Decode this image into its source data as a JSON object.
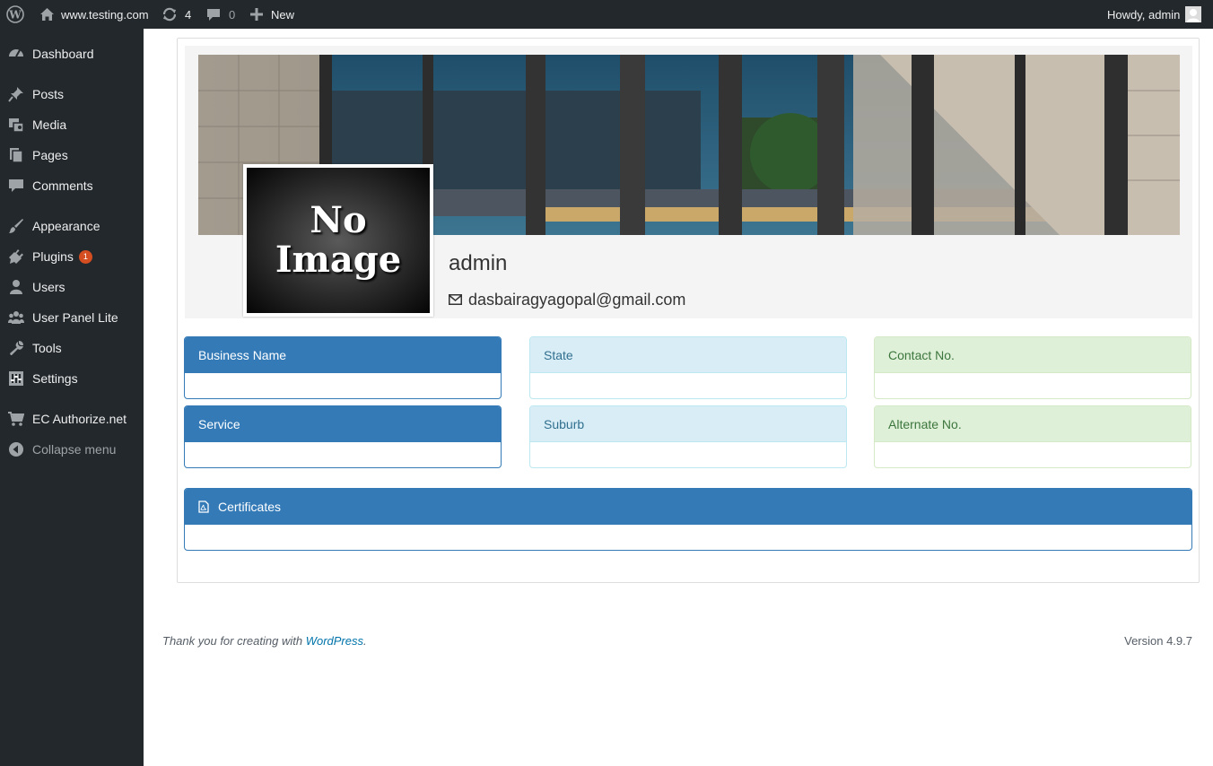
{
  "admin_bar": {
    "site_name": "www.testing.com",
    "updates_count": "4",
    "comments_count": "0",
    "new_label": "New",
    "howdy": "Howdy, admin"
  },
  "sidebar": {
    "items": [
      {
        "label": "Dashboard",
        "icon": "dashboard-icon"
      },
      {
        "label": "Posts",
        "icon": "pin-icon"
      },
      {
        "label": "Media",
        "icon": "media-icon"
      },
      {
        "label": "Pages",
        "icon": "pages-icon"
      },
      {
        "label": "Comments",
        "icon": "comment-icon"
      },
      {
        "label": "Appearance",
        "icon": "brush-icon"
      },
      {
        "label": "Plugins",
        "icon": "plug-icon",
        "badge": "1"
      },
      {
        "label": "Users",
        "icon": "user-icon"
      },
      {
        "label": "User Panel Lite",
        "icon": "group-icon"
      },
      {
        "label": "Tools",
        "icon": "wrench-icon"
      },
      {
        "label": "Settings",
        "icon": "sliders-icon"
      },
      {
        "label": "EC Authorize.net",
        "icon": "cart-icon"
      },
      {
        "label": "Collapse menu",
        "icon": "collapse-icon"
      }
    ]
  },
  "profile": {
    "avatar_text_line1": "No",
    "avatar_text_line2": "Image",
    "username": "admin",
    "email": "dasbairagyagopal@gmail.com"
  },
  "panels": {
    "business_name": "Business Name",
    "state": "State",
    "contact_no": "Contact No.",
    "service": "Service",
    "suburb": "Suburb",
    "alternate_no": "Alternate No.",
    "certificates": "Certificates"
  },
  "footer": {
    "thanks_prefix": "Thank you for creating with ",
    "wordpress_link": "WordPress",
    "thanks_suffix": ".",
    "version": "Version 4.9.7"
  },
  "colors": {
    "primary": "#337ab7",
    "info_bg": "#d9edf7",
    "success_bg": "#dff0d8",
    "adminbar_bg": "#23282d"
  }
}
